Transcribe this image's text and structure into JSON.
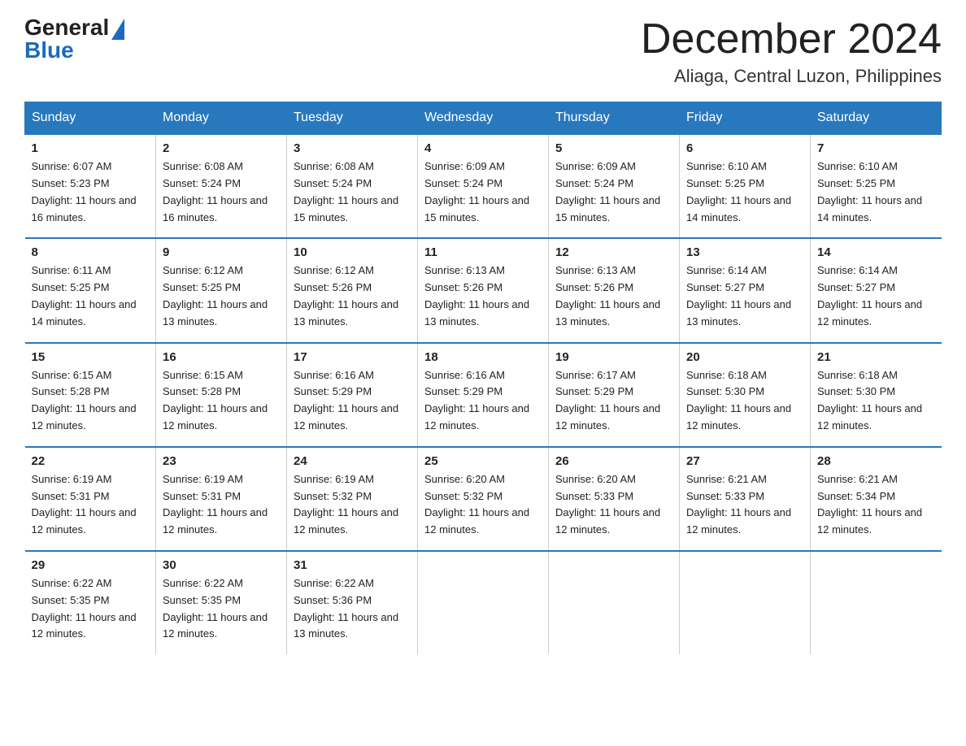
{
  "logo": {
    "general": "General",
    "blue": "Blue"
  },
  "title": "December 2024",
  "location": "Aliaga, Central Luzon, Philippines",
  "days_of_week": [
    "Sunday",
    "Monday",
    "Tuesday",
    "Wednesday",
    "Thursday",
    "Friday",
    "Saturday"
  ],
  "weeks": [
    [
      {
        "day": "1",
        "sunrise": "6:07 AM",
        "sunset": "5:23 PM",
        "daylight": "11 hours and 16 minutes."
      },
      {
        "day": "2",
        "sunrise": "6:08 AM",
        "sunset": "5:24 PM",
        "daylight": "11 hours and 16 minutes."
      },
      {
        "day": "3",
        "sunrise": "6:08 AM",
        "sunset": "5:24 PM",
        "daylight": "11 hours and 15 minutes."
      },
      {
        "day": "4",
        "sunrise": "6:09 AM",
        "sunset": "5:24 PM",
        "daylight": "11 hours and 15 minutes."
      },
      {
        "day": "5",
        "sunrise": "6:09 AM",
        "sunset": "5:24 PM",
        "daylight": "11 hours and 15 minutes."
      },
      {
        "day": "6",
        "sunrise": "6:10 AM",
        "sunset": "5:25 PM",
        "daylight": "11 hours and 14 minutes."
      },
      {
        "day": "7",
        "sunrise": "6:10 AM",
        "sunset": "5:25 PM",
        "daylight": "11 hours and 14 minutes."
      }
    ],
    [
      {
        "day": "8",
        "sunrise": "6:11 AM",
        "sunset": "5:25 PM",
        "daylight": "11 hours and 14 minutes."
      },
      {
        "day": "9",
        "sunrise": "6:12 AM",
        "sunset": "5:25 PM",
        "daylight": "11 hours and 13 minutes."
      },
      {
        "day": "10",
        "sunrise": "6:12 AM",
        "sunset": "5:26 PM",
        "daylight": "11 hours and 13 minutes."
      },
      {
        "day": "11",
        "sunrise": "6:13 AM",
        "sunset": "5:26 PM",
        "daylight": "11 hours and 13 minutes."
      },
      {
        "day": "12",
        "sunrise": "6:13 AM",
        "sunset": "5:26 PM",
        "daylight": "11 hours and 13 minutes."
      },
      {
        "day": "13",
        "sunrise": "6:14 AM",
        "sunset": "5:27 PM",
        "daylight": "11 hours and 13 minutes."
      },
      {
        "day": "14",
        "sunrise": "6:14 AM",
        "sunset": "5:27 PM",
        "daylight": "11 hours and 12 minutes."
      }
    ],
    [
      {
        "day": "15",
        "sunrise": "6:15 AM",
        "sunset": "5:28 PM",
        "daylight": "11 hours and 12 minutes."
      },
      {
        "day": "16",
        "sunrise": "6:15 AM",
        "sunset": "5:28 PM",
        "daylight": "11 hours and 12 minutes."
      },
      {
        "day": "17",
        "sunrise": "6:16 AM",
        "sunset": "5:29 PM",
        "daylight": "11 hours and 12 minutes."
      },
      {
        "day": "18",
        "sunrise": "6:16 AM",
        "sunset": "5:29 PM",
        "daylight": "11 hours and 12 minutes."
      },
      {
        "day": "19",
        "sunrise": "6:17 AM",
        "sunset": "5:29 PM",
        "daylight": "11 hours and 12 minutes."
      },
      {
        "day": "20",
        "sunrise": "6:18 AM",
        "sunset": "5:30 PM",
        "daylight": "11 hours and 12 minutes."
      },
      {
        "day": "21",
        "sunrise": "6:18 AM",
        "sunset": "5:30 PM",
        "daylight": "11 hours and 12 minutes."
      }
    ],
    [
      {
        "day": "22",
        "sunrise": "6:19 AM",
        "sunset": "5:31 PM",
        "daylight": "11 hours and 12 minutes."
      },
      {
        "day": "23",
        "sunrise": "6:19 AM",
        "sunset": "5:31 PM",
        "daylight": "11 hours and 12 minutes."
      },
      {
        "day": "24",
        "sunrise": "6:19 AM",
        "sunset": "5:32 PM",
        "daylight": "11 hours and 12 minutes."
      },
      {
        "day": "25",
        "sunrise": "6:20 AM",
        "sunset": "5:32 PM",
        "daylight": "11 hours and 12 minutes."
      },
      {
        "day": "26",
        "sunrise": "6:20 AM",
        "sunset": "5:33 PM",
        "daylight": "11 hours and 12 minutes."
      },
      {
        "day": "27",
        "sunrise": "6:21 AM",
        "sunset": "5:33 PM",
        "daylight": "11 hours and 12 minutes."
      },
      {
        "day": "28",
        "sunrise": "6:21 AM",
        "sunset": "5:34 PM",
        "daylight": "11 hours and 12 minutes."
      }
    ],
    [
      {
        "day": "29",
        "sunrise": "6:22 AM",
        "sunset": "5:35 PM",
        "daylight": "11 hours and 12 minutes."
      },
      {
        "day": "30",
        "sunrise": "6:22 AM",
        "sunset": "5:35 PM",
        "daylight": "11 hours and 12 minutes."
      },
      {
        "day": "31",
        "sunrise": "6:22 AM",
        "sunset": "5:36 PM",
        "daylight": "11 hours and 13 minutes."
      },
      null,
      null,
      null,
      null
    ]
  ]
}
